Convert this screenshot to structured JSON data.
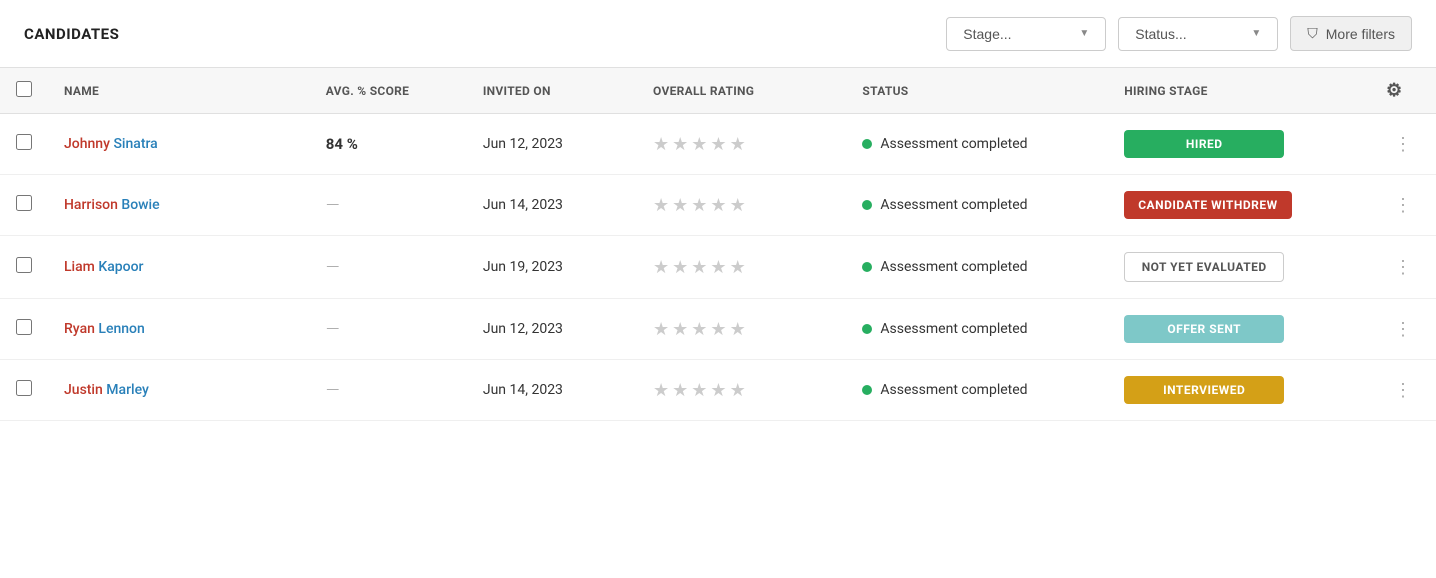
{
  "header": {
    "title": "CANDIDATES",
    "stage_placeholder": "Stage...",
    "status_placeholder": "Status...",
    "more_filters_label": "More filters"
  },
  "table": {
    "columns": {
      "checkbox": "",
      "name": "NAME",
      "avg_score": "AVG. % SCORE",
      "invited_on": "INVITED ON",
      "overall_rating": "OVERALL RATING",
      "status": "STATUS",
      "hiring_stage": "HIRING STAGE"
    },
    "rows": [
      {
        "id": 1,
        "name_first": "Johnny",
        "name_last": "Sinatra",
        "avg_score": "84 %",
        "invited_on": "Jun 12, 2023",
        "status_text": "Assessment completed",
        "hiring_stage": "HIRED",
        "badge_class": "badge-hired"
      },
      {
        "id": 2,
        "name_first": "Harrison",
        "name_last": "Bowie",
        "avg_score": "—",
        "invited_on": "Jun 14, 2023",
        "status_text": "Assessment completed",
        "hiring_stage": "CANDIDATE WITHDREW",
        "badge_class": "badge-withdrew"
      },
      {
        "id": 3,
        "name_first": "Liam",
        "name_last": "Kapoor",
        "avg_score": "—",
        "invited_on": "Jun 19, 2023",
        "status_text": "Assessment completed",
        "hiring_stage": "NOT YET EVALUATED",
        "badge_class": "badge-not-evaluated"
      },
      {
        "id": 4,
        "name_first": "Ryan",
        "name_last": "Lennon",
        "avg_score": "—",
        "invited_on": "Jun 12, 2023",
        "status_text": "Assessment completed",
        "hiring_stage": "OFFER SENT",
        "badge_class": "badge-offer-sent"
      },
      {
        "id": 5,
        "name_first": "Justin",
        "name_last": "Marley",
        "avg_score": "—",
        "invited_on": "Jun 14, 2023",
        "status_text": "Assessment completed",
        "hiring_stage": "INTERVIEWED",
        "badge_class": "badge-interviewed"
      }
    ]
  }
}
